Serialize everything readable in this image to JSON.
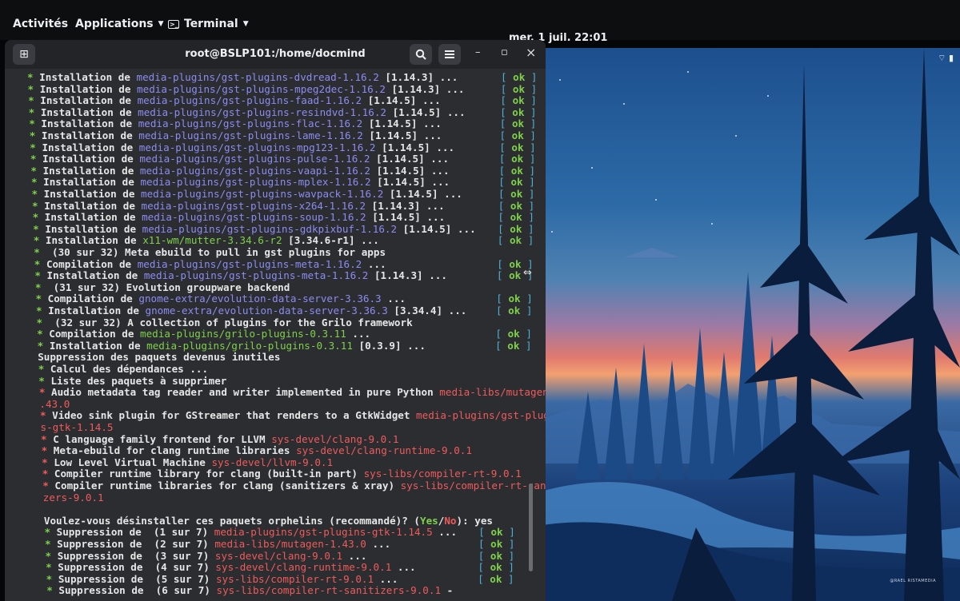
{
  "topbar": {
    "activities": "Activités",
    "applications": "Applications",
    "terminal": "Terminal",
    "clock": "mer. 1 juil.  22:01"
  },
  "terminal": {
    "title": "root@BSLP101:/home/docmind",
    "new_tab_icon": "new-tab-icon",
    "search_icon": "search-icon",
    "menu_icon": "hamburger-menu-icon",
    "minimize": "–",
    "maximize": "▫",
    "close": "×"
  },
  "ok_text": "ok",
  "lines": [
    {
      "bullet": "*",
      "pre": " Installation de ",
      "pkg": "media-plugins/gst-plugins-dvdread-1.16.2",
      "post": " [1.14.3] ...",
      "kind": "blue",
      "ok": true
    },
    {
      "bullet": "*",
      "pre": " Installation de ",
      "pkg": "media-plugins/gst-plugins-mpeg2dec-1.16.2",
      "post": " [1.14.3] ...",
      "kind": "blue",
      "ok": true
    },
    {
      "bullet": "*",
      "pre": " Installation de ",
      "pkg": "media-plugins/gst-plugins-faad-1.16.2",
      "post": " [1.14.5] ...",
      "kind": "blue",
      "ok": true
    },
    {
      "bullet": "*",
      "pre": " Installation de ",
      "pkg": "media-plugins/gst-plugins-resindvd-1.16.2",
      "post": " [1.14.5] ...",
      "kind": "blue",
      "ok": true
    },
    {
      "bullet": "*",
      "pre": " Installation de ",
      "pkg": "media-plugins/gst-plugins-flac-1.16.2",
      "post": " [1.14.5] ...",
      "kind": "blue",
      "ok": true
    },
    {
      "bullet": "*",
      "pre": " Installation de ",
      "pkg": "media-plugins/gst-plugins-lame-1.16.2",
      "post": " [1.14.5] ...",
      "kind": "blue",
      "ok": true
    },
    {
      "bullet": "*",
      "pre": " Installation de ",
      "pkg": "media-plugins/gst-plugins-mpg123-1.16.2",
      "post": " [1.14.5] ...",
      "kind": "blue",
      "ok": true
    },
    {
      "bullet": "*",
      "pre": " Installation de ",
      "pkg": "media-plugins/gst-plugins-pulse-1.16.2",
      "post": " [1.14.5] ...",
      "kind": "blue",
      "ok": true
    },
    {
      "bullet": "*",
      "pre": " Installation de ",
      "pkg": "media-plugins/gst-plugins-vaapi-1.16.2",
      "post": " [1.14.5] ...",
      "kind": "blue",
      "ok": true
    },
    {
      "bullet": "*",
      "pre": " Installation de ",
      "pkg": "media-plugins/gst-plugins-mplex-1.16.2",
      "post": " [1.14.5] ...",
      "kind": "blue",
      "ok": true
    },
    {
      "bullet": "*",
      "pre": " Installation de ",
      "pkg": "media-plugins/gst-plugins-wavpack-1.16.2",
      "post": " [1.14.5] ...",
      "kind": "blue",
      "ok": true
    },
    {
      "bullet": "*",
      "pre": " Installation de ",
      "pkg": "media-plugins/gst-plugins-x264-1.16.2",
      "post": " [1.14.3] ...",
      "kind": "blue",
      "ok": true
    },
    {
      "bullet": "*",
      "pre": " Installation de ",
      "pkg": "media-plugins/gst-plugins-soup-1.16.2",
      "post": " [1.14.5] ...",
      "kind": "blue",
      "ok": true
    },
    {
      "bullet": "*",
      "pre": " Installation de ",
      "pkg": "media-plugins/gst-plugins-gdkpixbuf-1.16.2",
      "post": " [1.14.5] ...",
      "kind": "blue",
      "ok": true
    },
    {
      "bullet": "*",
      "pre": " Installation de ",
      "pkg": "x11-wm/mutter-3.34.6-r2",
      "post": " [3.34.6-r1] ...",
      "kind": "green",
      "ok": true
    },
    {
      "bullet": "*",
      "pre": "  (30 sur 32) Meta ebuild to pull in gst plugins for apps",
      "pkg": "",
      "post": "",
      "kind": "plain",
      "ok": false
    },
    {
      "bullet": "*",
      "pre": " Compilation de ",
      "pkg": "media-plugins/gst-plugins-meta-1.16.2",
      "post": " ...",
      "kind": "blue",
      "ok": true
    },
    {
      "bullet": "*",
      "pre": " Installation de ",
      "pkg": "media-plugins/gst-plugins-meta-1.16.2",
      "post": " [1.14.3] ...",
      "kind": "blue",
      "ok": true
    },
    {
      "bullet": "*",
      "pre": "  (31 sur 32) Evolution groupware backend",
      "pkg": "",
      "post": "",
      "kind": "plain",
      "ok": false
    },
    {
      "bullet": "*",
      "pre": " Compilation de ",
      "pkg": "gnome-extra/evolution-data-server-3.36.3",
      "post": " ...",
      "kind": "blue",
      "ok": true
    },
    {
      "bullet": "*",
      "pre": " Installation de ",
      "pkg": "gnome-extra/evolution-data-server-3.36.3",
      "post": " [3.34.4] ...",
      "kind": "blue",
      "ok": true
    },
    {
      "bullet": "*",
      "pre": "  (32 sur 32) A collection of plugins for the Grilo framework",
      "pkg": "",
      "post": "",
      "kind": "plain",
      "ok": false
    },
    {
      "bullet": "*",
      "pre": " Compilation de ",
      "pkg": "media-plugins/grilo-plugins-0.3.11",
      "post": " ...",
      "kind": "green",
      "ok": true
    },
    {
      "bullet": "*",
      "pre": " Installation de ",
      "pkg": "media-plugins/grilo-plugins-0.3.11",
      "post": " [0.3.9] ...",
      "kind": "green",
      "ok": true
    },
    {
      "bullet": "",
      "pre": "Suppression des paquets devenus inutiles",
      "pkg": "",
      "post": "",
      "kind": "plain",
      "ok": false
    },
    {
      "bullet": "*",
      "pre": " Calcul des dépendances ...",
      "pkg": "",
      "post": "",
      "kind": "plain",
      "ok": false
    },
    {
      "bullet": "*",
      "pre": " Liste des paquets à supprimer",
      "pkg": "",
      "post": "",
      "kind": "plain",
      "ok": false
    },
    {
      "bullet": "*",
      "pre": " Audio metadata tag reader and writer implemented in pure Python ",
      "pkg": "media-libs/mutagen-1",
      "post": "",
      "kind": "red",
      "ok": false
    },
    {
      "bullet": "",
      "pre": "",
      "pkg": ".43.0",
      "post": "",
      "kind": "red",
      "ok": false
    },
    {
      "bullet": "*",
      "pre": " Video sink plugin for GStreamer that renders to a GtkWidget ",
      "pkg": "media-plugins/gst-plugin",
      "post": "",
      "kind": "red",
      "ok": false
    },
    {
      "bullet": "",
      "pre": "",
      "pkg": "s-gtk-1.14.5",
      "post": "",
      "kind": "red",
      "ok": false
    },
    {
      "bullet": "*",
      "pre": " C language family frontend for LLVM ",
      "pkg": "sys-devel/clang-9.0.1",
      "post": "",
      "kind": "red",
      "ok": false
    },
    {
      "bullet": "*",
      "pre": " Meta-ebuild for clang runtime libraries ",
      "pkg": "sys-devel/clang-runtime-9.0.1",
      "post": "",
      "kind": "red",
      "ok": false
    },
    {
      "bullet": "*",
      "pre": " Low Level Virtual Machine ",
      "pkg": "sys-devel/llvm-9.0.1",
      "post": "",
      "kind": "red",
      "ok": false
    },
    {
      "bullet": "*",
      "pre": " Compiler runtime library for clang (built-in part) ",
      "pkg": "sys-libs/compiler-rt-9.0.1",
      "post": "",
      "kind": "red",
      "ok": false
    },
    {
      "bullet": "*",
      "pre": " Compiler runtime libraries for clang (sanitizers & xray) ",
      "pkg": "sys-libs/compiler-rt-saniti",
      "post": "",
      "kind": "red",
      "ok": false
    },
    {
      "bullet": "",
      "pre": "",
      "pkg": "zers-9.0.1",
      "post": "",
      "kind": "red",
      "ok": false
    },
    {
      "bullet": "",
      "pre": "",
      "pkg": "",
      "post": "",
      "kind": "plain",
      "ok": false
    },
    {
      "bullet": "",
      "pre": "Voulez-vous désinstaller ces paquets orphelins (recommandé)? (",
      "pkg": "",
      "post": "",
      "kind": "prompt",
      "ok": false
    },
    {
      "bullet": "*",
      "pre": " Suppression de  (1 sur 7) ",
      "pkg": "media-plugins/gst-plugins-gtk-1.14.5",
      "post": " ...",
      "kind": "red",
      "ok": true
    },
    {
      "bullet": "*",
      "pre": " Suppression de  (2 sur 7) ",
      "pkg": "media-libs/mutagen-1.43.0",
      "post": " ...",
      "kind": "red",
      "ok": true
    },
    {
      "bullet": "*",
      "pre": " Suppression de  (3 sur 7) ",
      "pkg": "sys-devel/clang-9.0.1",
      "post": " ...",
      "kind": "red",
      "ok": true
    },
    {
      "bullet": "*",
      "pre": " Suppression de  (4 sur 7) ",
      "pkg": "sys-devel/clang-runtime-9.0.1",
      "post": " ...",
      "kind": "red",
      "ok": true
    },
    {
      "bullet": "*",
      "pre": " Suppression de  (5 sur 7) ",
      "pkg": "sys-libs/compiler-rt-9.0.1",
      "post": " ...",
      "kind": "red",
      "ok": true
    },
    {
      "bullet": "*",
      "pre": " Suppression de  (6 sur 7) ",
      "pkg": "sys-libs/compiler-rt-sanitizers-9.0.1",
      "post": " -",
      "kind": "red",
      "ok": false
    }
  ],
  "prompt": {
    "yes": "Yes",
    "slash": "/",
    "no": "No",
    "tail": "): yes"
  },
  "wallpaper_credit": "@RAEL RISTAMEDIA",
  "colors": {
    "bullet_green": "#7fd14a",
    "package_blue": "#8c8cf0",
    "package_red": "#ef5b5b",
    "ok_bracket": "#4fb0d6"
  }
}
